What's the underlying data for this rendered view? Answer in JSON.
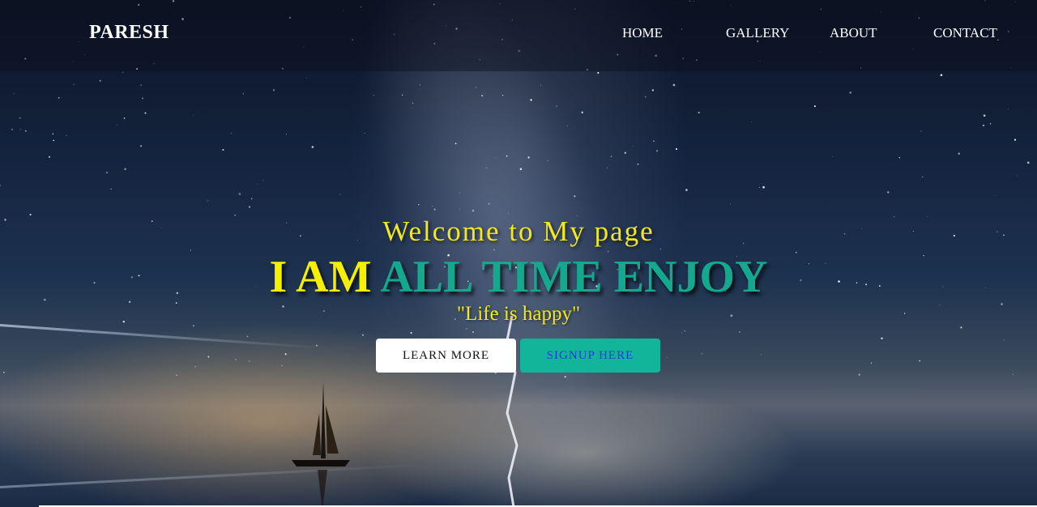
{
  "brand": "PARESH",
  "nav": {
    "items": [
      {
        "label": "HOME"
      },
      {
        "label": "GALLERY"
      },
      {
        "label": "ABOUT"
      },
      {
        "label": "CONTACT"
      }
    ]
  },
  "hero": {
    "welcome": "Welcome to My page",
    "headline_part1": "I AM",
    "headline_part2": "ALL TIME ENJOY",
    "tagline": "\"Life is happy\"",
    "buttons": {
      "learn_more": "LEARN MORE",
      "signup": "SIGNUP HERE"
    }
  },
  "colors": {
    "accent_yellow": "#f5f000",
    "accent_teal": "#14a98f",
    "signup_button_bg": "#13b59a",
    "signup_button_text": "#1a3ad8"
  },
  "icons": [
    "sailboat-silhouette",
    "starry-sky-background"
  ]
}
